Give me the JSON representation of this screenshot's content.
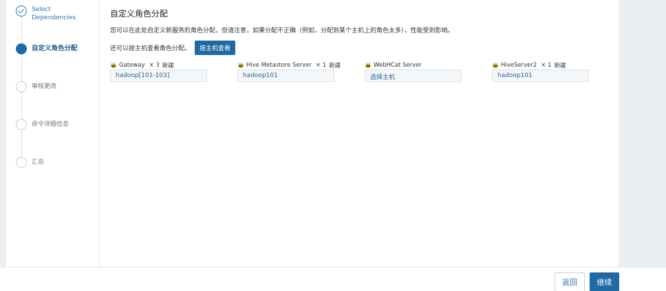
{
  "steps": [
    {
      "label": "Select Dependencies",
      "state": "done"
    },
    {
      "label": "自定义角色分配",
      "state": "active"
    },
    {
      "label": "审核更改",
      "state": "pending"
    },
    {
      "label": "命令详细信息",
      "state": "pending"
    },
    {
      "label": "汇总",
      "state": "pending"
    }
  ],
  "main": {
    "title": "自定义角色分配",
    "description": "您可以在此处自定义新服务的角色分配，但请注意，如果分配不正确（例如，分配到某个主机上的角色太多），性能受到影响。",
    "host_view_prefix": "还可以按主机查看角色分配。",
    "host_view_button": "按主机查看"
  },
  "roles": [
    {
      "name": "Gateway",
      "count": "× 3",
      "badge": "新建",
      "hosts": "hadoop[101-103]"
    },
    {
      "name": "Hive Metastore Server",
      "count": "× 1",
      "badge": "新建",
      "hosts": "hadoop101"
    },
    {
      "name": "WebHCat Server",
      "count": "",
      "badge": "",
      "hosts": "选择主机"
    },
    {
      "name": "HiveServer2",
      "count": "× 1",
      "badge": "新建",
      "hosts": "hadoop101"
    }
  ],
  "footer": {
    "back_label": "返回",
    "continue_label": "继续"
  },
  "colors": {
    "accent": "#1f6aa5",
    "link": "#2b73b0",
    "background_gutter": "#eceff1"
  },
  "icons": {
    "step_done": "checkmark-icon",
    "role": "hive-bee-icon"
  }
}
